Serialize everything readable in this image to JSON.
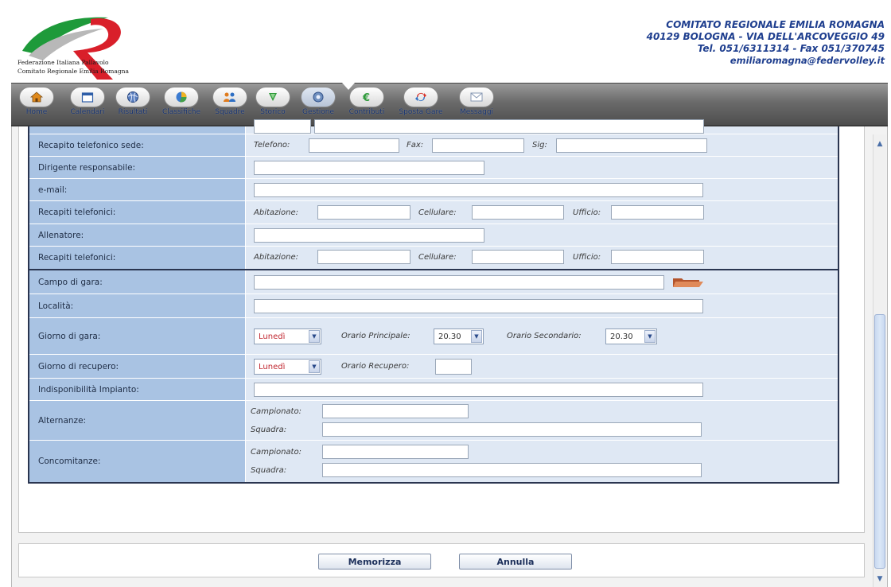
{
  "header": {
    "logo_line1": "Federazione Italiana Pallavolo",
    "logo_line2": "Comitato Regionale Emilia Romagna",
    "contact_name": "COMITATO REGIONALE EMILIA ROMAGNA",
    "contact_address": "40129 BOLOGNA - VIA DELL'ARCOVEGGIO 49",
    "contact_phone": "Tel. 051/6311314 - Fax 051/370745",
    "contact_email": "emiliaromagna@federvolley.it"
  },
  "nav": [
    {
      "label": "Home",
      "icon": "home-icon"
    },
    {
      "label": "Calendari",
      "icon": "calendar-icon"
    },
    {
      "label": "Risultati",
      "icon": "volleyball-icon"
    },
    {
      "label": "Classifiche",
      "icon": "chart-icon"
    },
    {
      "label": "Squadre",
      "icon": "team-icon"
    },
    {
      "label": "Storico",
      "icon": "history-icon"
    },
    {
      "label": "Gestione",
      "icon": "settings-icon"
    },
    {
      "label": "Contributi",
      "icon": "euro-icon"
    },
    {
      "label": "Sposta Gare",
      "icon": "move-icon"
    },
    {
      "label": "Messaggi",
      "icon": "mail-icon"
    }
  ],
  "form": {
    "recapito_sede_label": "Recapito telefonico sede:",
    "telefono_label": "Telefono:",
    "fax_label": "Fax:",
    "sig_label": "Sig:",
    "dirigente_label": "Dirigente responsabile:",
    "email_label": "e-mail:",
    "recapiti_label": "Recapiti telefonici:",
    "abitazione_label": "Abitazione:",
    "cellulare_label": "Cellulare:",
    "ufficio_label": "Ufficio:",
    "allenatore_label": "Allenatore:",
    "campo_label": "Campo di gara:",
    "localita_label": "Località:",
    "giorno_gara_label": "Giorno di gara:",
    "giorno_gara_value": "Lunedì",
    "orario_principale_label": "Orario Principale:",
    "orario_principale_value": "20.30",
    "orario_secondario_label": "Orario Secondario:",
    "orario_secondario_value": "20.30",
    "giorno_recupero_label": "Giorno di recupero:",
    "giorno_recupero_value": "Lunedì",
    "orario_recupero_label": "Orario Recupero:",
    "indisponibilita_label": "Indisponibilità Impianto:",
    "alternanze_label": "Alternanze:",
    "concomitanze_label": "Concomitanze:",
    "campionato_label": "Campionato:",
    "squadra_label": "Squadra:"
  },
  "buttons": {
    "save": "Memorizza",
    "cancel": "Annulla"
  },
  "colors": {
    "label_cell": "#a9c3e3",
    "value_cell": "#dfe8f4",
    "contact_text": "#1f3f8f",
    "select_text": "#c0262f"
  }
}
